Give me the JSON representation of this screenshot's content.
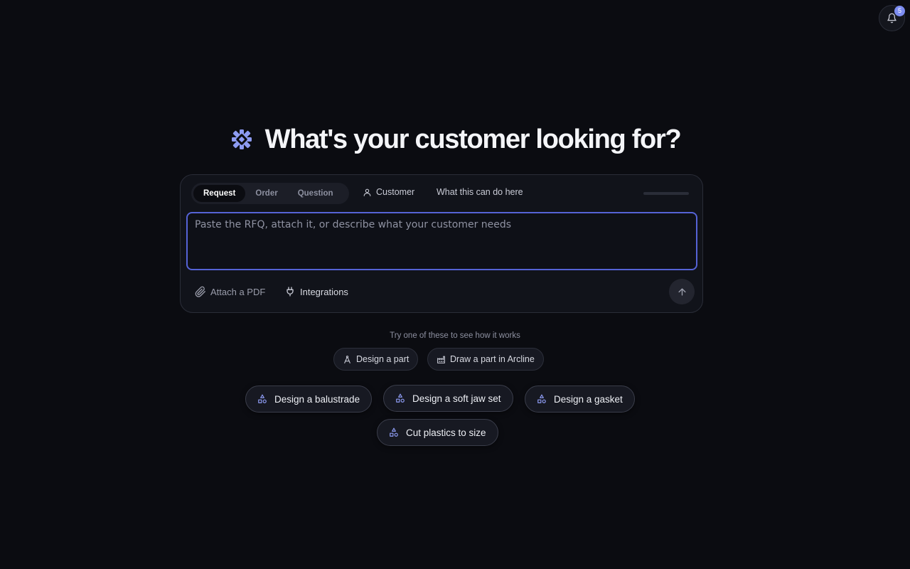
{
  "notifications": {
    "count": "5"
  },
  "hero": {
    "title": "What's your customer looking for?"
  },
  "composer": {
    "modes": [
      "Request",
      "Order",
      "Question"
    ],
    "active_mode": "Request",
    "customer_label": "Customer",
    "help_label": "What this can do here",
    "placeholder": "Paste the RFQ, attach it, or describe what your customer needs",
    "attach_label": "Attach a PDF",
    "integrations_label": "Integrations"
  },
  "suggestions": {
    "hint": "Try one of these to see how it works",
    "chips": [
      "Design a part",
      "Draw a part in Arcline"
    ],
    "examples": [
      "Design a balustrade",
      "Design a soft jaw set",
      "Design a gasket",
      "Cut plastics to size"
    ]
  },
  "colors": {
    "accent": "#7c8cf0",
    "focus_border": "#5563d6",
    "background": "#0b0c11"
  }
}
